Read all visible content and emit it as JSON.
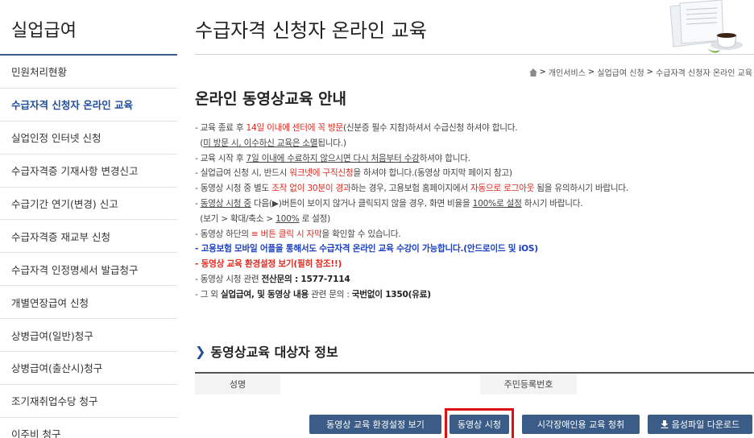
{
  "sidebar": {
    "title": "실업급여",
    "items": [
      {
        "label": "민원처리현황"
      },
      {
        "label": "수급자격 신청자 온라인 교육"
      },
      {
        "label": "실업인정 인터넷 신청"
      },
      {
        "label": "수급자격증 기재사항 변경신고"
      },
      {
        "label": "수급기간 연기(변경) 신고"
      },
      {
        "label": "수급자격증 재교부 신청"
      },
      {
        "label": "수급자격 인정명세서 발급청구"
      },
      {
        "label": "개별연장급여 신청"
      },
      {
        "label": "상병급여(일반)청구"
      },
      {
        "label": "상병급여(출산시)청구"
      },
      {
        "label": "조기재취업수당 청구"
      },
      {
        "label": "이주비 청구"
      }
    ]
  },
  "header": {
    "title": "수급자격 신청자 온라인 교육"
  },
  "breadcrumb": {
    "items": [
      "개인서비스",
      "실업급여 신청",
      "수급자격 신청자 온라인 교육"
    ],
    "separator": ">"
  },
  "section": {
    "title": "온라인 동영상교육 안내"
  },
  "notice": {
    "l1": [
      "- 교육 종료 후 ",
      "14일 이내에 센터에 꼭 방문",
      "(신분증 필수 지참)하셔서 수급신청 하셔야 합니다."
    ],
    "l2": [
      "(",
      "미 방문 시, 이수하신 교육은 소멸",
      "됩니다.)"
    ],
    "l3": [
      "- 교육 시작 후 ",
      "7일 이내에 수료하지 않으시면 다시 처음부터 수강",
      "하셔야 합니다."
    ],
    "l4": [
      "- 실업급여 신청 시, 반드시 ",
      "워크넷에 구직신청",
      "을 하셔야 합니다.(동영상 마지막 페이지 참고)"
    ],
    "l5": [
      "- 동영상 시청 중 별도 ",
      "조작 없이 30분이 경과",
      "하는 경우, 고용보험 홈페이지에서 ",
      "자동으로 로그아웃",
      " 됨을 유의하시기 바랍니다."
    ],
    "l6": [
      "- ",
      "동영상 시청 중",
      " 다음(▶)버튼이 보이지 않거나 클릭되지 않을 경우, 화면 비율을 ",
      "100%로 설정",
      " 하시기 바랍니다."
    ],
    "l7": [
      "(보기 > 확대/축소 > ",
      "100%",
      " 로 설정)"
    ],
    "l8": [
      "- 동영상 하단의 ",
      "≡ 버튼 클릭 시 자막",
      "을 확인할 수 있습니다."
    ],
    "l9": "- 고용보험 모바일 어플을 통해서도 수급자격 온라인 교육 수강이 가능합니다.(안드로이드 및 iOS)",
    "l10": "- 동영상 교육 환경설정 보기(필히 참조!!)",
    "l11": [
      "- 동영상 시청 관련 ",
      "전산문의 : 1577-7114"
    ],
    "l12": [
      "- 그 외 ",
      "실업급여, 및 동영상 내용",
      " 관련 문의 : ",
      "국번없이 1350(유료)"
    ]
  },
  "target_info": {
    "title": "동영상교육 대상자 정보",
    "col_name": "성명",
    "col_id": "주민등록번호"
  },
  "buttons": {
    "settings": "동영상 교육 환경설정 보기",
    "watch": "동영상 시청",
    "visual_impaired": "시각장애인용 교육 청취",
    "download": "음성파일 다운로드"
  },
  "colors": {
    "accent": "#3a5c86",
    "highlight": "#e01010",
    "red_text": "#e0281e",
    "blue_text": "#1a3fbf"
  },
  "icons": {
    "breadcrumb_home": "home-icon",
    "download": "download-icon",
    "section_arrow": "chevron-right-icon"
  }
}
